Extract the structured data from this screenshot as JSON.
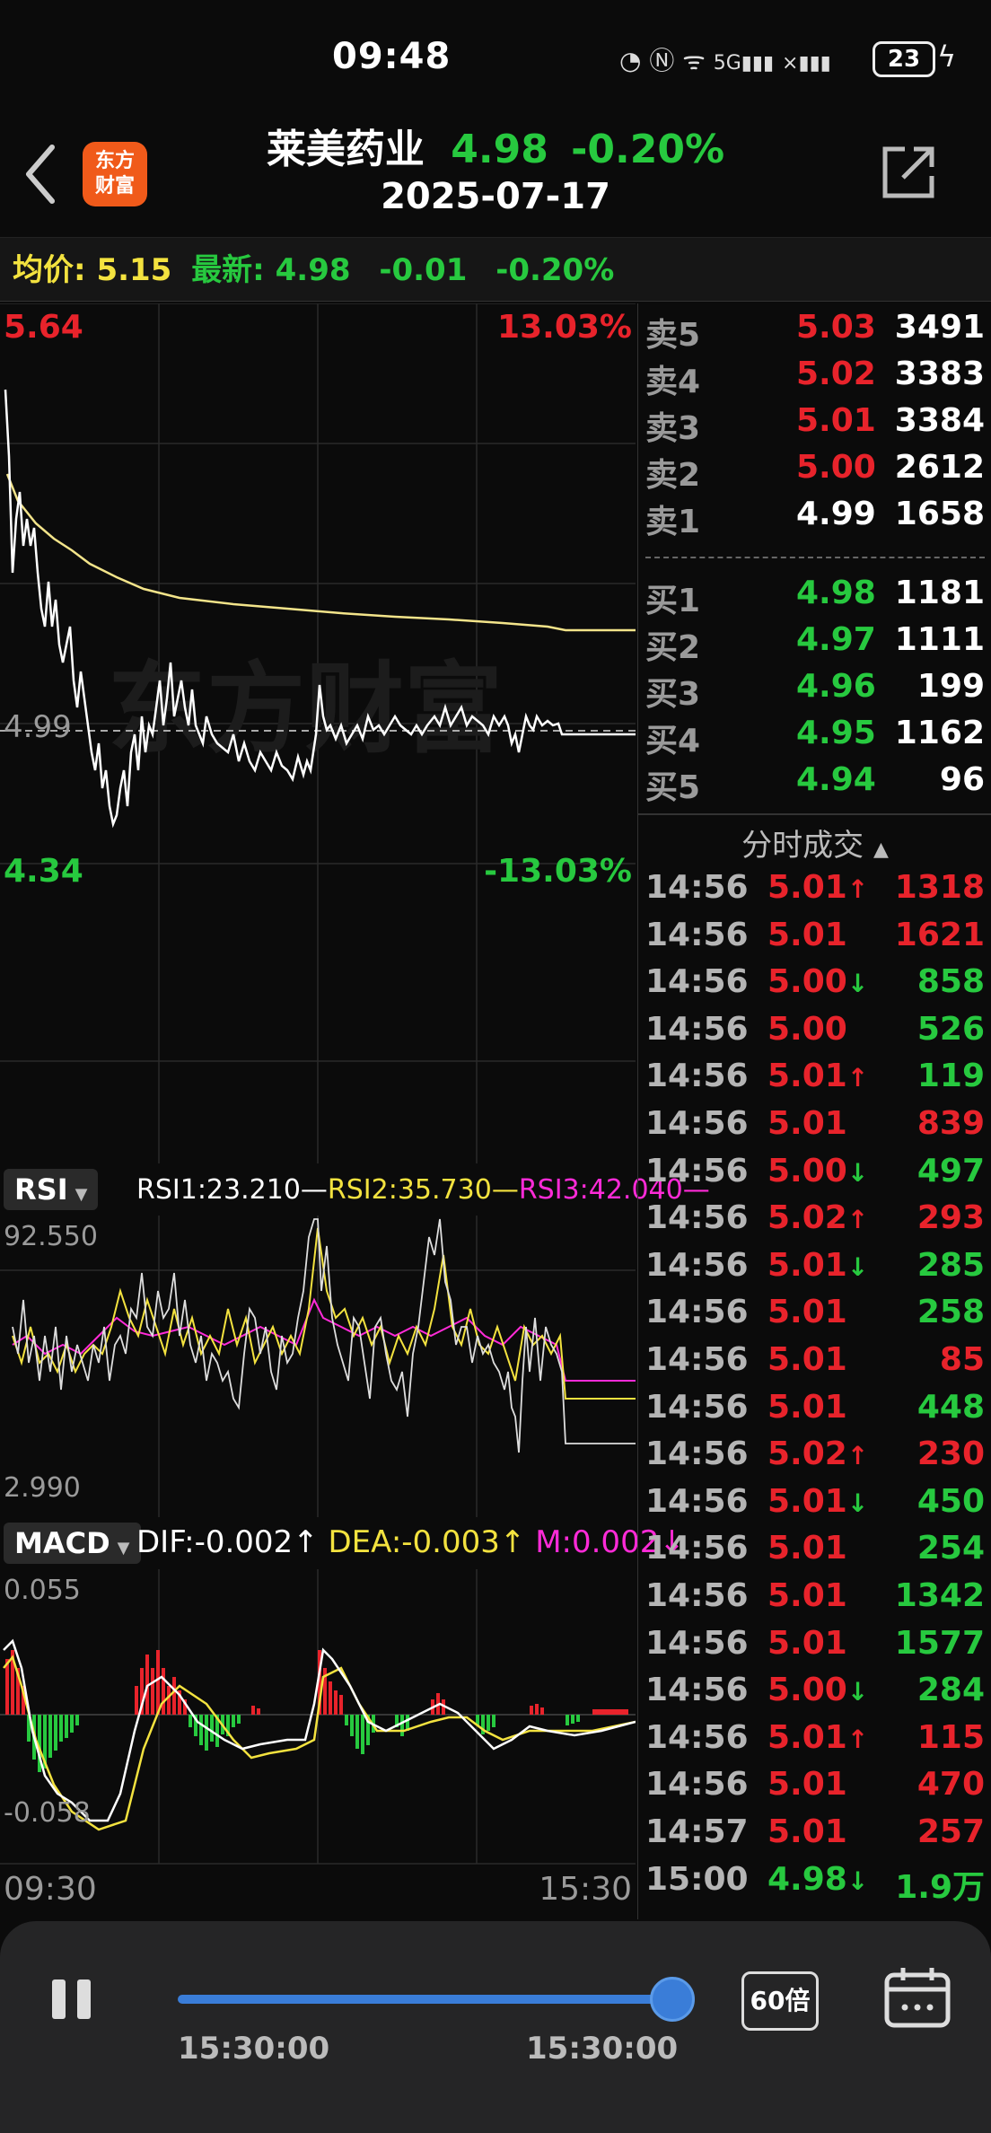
{
  "status": {
    "time": "09:48",
    "battery": "23"
  },
  "header": {
    "logo_line1": "东方",
    "logo_line2": "财富",
    "stock_name": "莱美药业",
    "price": "4.98",
    "change_pct": "-0.20%",
    "date": "2025-07-17"
  },
  "info": {
    "avg_label": "均价:",
    "avg_value": "5.15",
    "last_label": "最新:",
    "last_value": "4.98",
    "last_change": "-0.01",
    "last_change_pct": "-0.20%"
  },
  "chart": {
    "top_price": "5.64",
    "top_pct": "13.03%",
    "ref_price": "4.99",
    "bottom_price": "4.34",
    "bottom_pct": "-13.03%",
    "watermark": "东方财富",
    "time_start": "09:30",
    "time_end": "15:30"
  },
  "rsi": {
    "button": "RSI",
    "rsi1": "RSI1:23.210",
    "rsi2": "RSI2:35.730",
    "rsi3": "RSI3:42.040",
    "max": "92.550",
    "min": "2.990"
  },
  "macd": {
    "button": "MACD",
    "dif": "DIF:-0.002",
    "dea": "DEA:-0.003",
    "m": "M:0.002",
    "max": "0.055",
    "min": "-0.058"
  },
  "orderbook": {
    "asks": [
      {
        "label": "卖5",
        "price": "5.03",
        "volume": "3491"
      },
      {
        "label": "卖4",
        "price": "5.02",
        "volume": "3383"
      },
      {
        "label": "卖3",
        "price": "5.01",
        "volume": "3384"
      },
      {
        "label": "卖2",
        "price": "5.00",
        "volume": "2612"
      },
      {
        "label": "卖1",
        "price": "4.99",
        "volume": "1658"
      }
    ],
    "bids": [
      {
        "label": "买1",
        "price": "4.98",
        "volume": "1181"
      },
      {
        "label": "买2",
        "price": "4.97",
        "volume": "1111"
      },
      {
        "label": "买3",
        "price": "4.96",
        "volume": "199"
      },
      {
        "label": "买4",
        "price": "4.95",
        "volume": "1162"
      },
      {
        "label": "买5",
        "price": "4.94",
        "volume": "96"
      }
    ]
  },
  "trades_title": "分时成交",
  "trades": [
    {
      "time": "14:56",
      "price": "5.01",
      "dir": "up",
      "volume": "1318",
      "vcolor": "red"
    },
    {
      "time": "14:56",
      "price": "5.01",
      "dir": "",
      "volume": "1621",
      "vcolor": "red"
    },
    {
      "time": "14:56",
      "price": "5.00",
      "dir": "down",
      "volume": "858",
      "vcolor": "green"
    },
    {
      "time": "14:56",
      "price": "5.00",
      "dir": "",
      "volume": "526",
      "vcolor": "green"
    },
    {
      "time": "14:56",
      "price": "5.01",
      "dir": "up",
      "volume": "119",
      "vcolor": "green"
    },
    {
      "time": "14:56",
      "price": "5.01",
      "dir": "",
      "volume": "839",
      "vcolor": "red"
    },
    {
      "time": "14:56",
      "price": "5.00",
      "dir": "down",
      "volume": "497",
      "vcolor": "green"
    },
    {
      "time": "14:56",
      "price": "5.02",
      "dir": "up",
      "volume": "293",
      "vcolor": "red"
    },
    {
      "time": "14:56",
      "price": "5.01",
      "dir": "down",
      "volume": "285",
      "vcolor": "green"
    },
    {
      "time": "14:56",
      "price": "5.01",
      "dir": "",
      "volume": "258",
      "vcolor": "green"
    },
    {
      "time": "14:56",
      "price": "5.01",
      "dir": "",
      "volume": "85",
      "vcolor": "red"
    },
    {
      "time": "14:56",
      "price": "5.01",
      "dir": "",
      "volume": "448",
      "vcolor": "green"
    },
    {
      "time": "14:56",
      "price": "5.02",
      "dir": "up",
      "volume": "230",
      "vcolor": "red"
    },
    {
      "time": "14:56",
      "price": "5.01",
      "dir": "down",
      "volume": "450",
      "vcolor": "green"
    },
    {
      "time": "14:56",
      "price": "5.01",
      "dir": "",
      "volume": "254",
      "vcolor": "green"
    },
    {
      "time": "14:56",
      "price": "5.01",
      "dir": "",
      "volume": "1342",
      "vcolor": "green"
    },
    {
      "time": "14:56",
      "price": "5.01",
      "dir": "",
      "volume": "1577",
      "vcolor": "green"
    },
    {
      "time": "14:56",
      "price": "5.00",
      "dir": "down",
      "volume": "284",
      "vcolor": "green"
    },
    {
      "time": "14:56",
      "price": "5.01",
      "dir": "up",
      "volume": "115",
      "vcolor": "red"
    },
    {
      "time": "14:56",
      "price": "5.01",
      "dir": "",
      "volume": "470",
      "vcolor": "red"
    },
    {
      "time": "14:57",
      "price": "5.01",
      "dir": "",
      "volume": "257",
      "vcolor": "red"
    },
    {
      "time": "15:00",
      "price": "4.98",
      "dir": "down",
      "volume": "1.9万",
      "vcolor": "green"
    }
  ],
  "playback": {
    "start_time": "15:30:00",
    "end_time": "15:30:00",
    "speed": "60倍",
    "progress": 1.0
  }
}
